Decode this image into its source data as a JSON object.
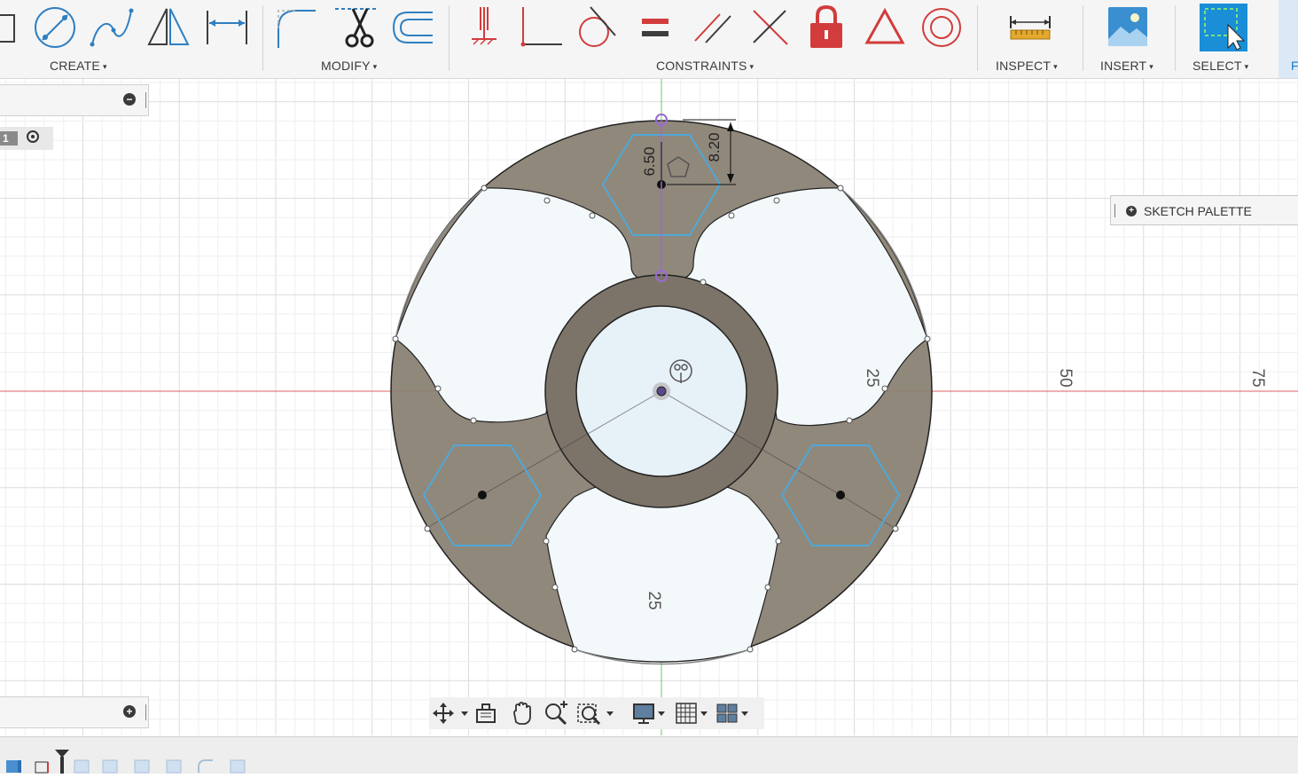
{
  "toolbar": {
    "groups": [
      {
        "label": "CREATE",
        "caret": "▾"
      },
      {
        "label": "MODIFY",
        "caret": "▾"
      },
      {
        "label": "CONSTRAINTS",
        "caret": "▾"
      },
      {
        "label": "INSPECT",
        "caret": "▾"
      },
      {
        "label": "INSERT",
        "caret": "▾"
      },
      {
        "label": "SELECT",
        "caret": "▾"
      }
    ],
    "edge_tab_label": "F",
    "create_tools": [
      "rectangle-icon",
      "circle-icon",
      "spline-icon",
      "mirror-icon",
      "dimension-icon"
    ],
    "modify_tools": [
      "fillet-icon",
      "trim-icon",
      "offset-icon"
    ],
    "constraint_tools": [
      "fix-icon",
      "coincident-icon",
      "tangent-icon",
      "equal-icon",
      "parallel-icon",
      "perpendicular-icon",
      "lock-icon",
      "triangle-icon",
      "concentric-icon"
    ],
    "inspect_tools": [
      "measure-icon"
    ],
    "insert_tools": [
      "insert-image-icon"
    ],
    "select_tools": [
      "select-icon"
    ]
  },
  "browser": {
    "row_number": "1"
  },
  "sketch_palette": {
    "label": "SKETCH PALETTE"
  },
  "canvas": {
    "dimension_a": "6.50",
    "dimension_b": "8.20",
    "axis_labels": [
      "25",
      "50",
      "75"
    ],
    "vertical_axis_label": "25"
  },
  "nav_bar": {
    "icons": [
      "orbit-icon",
      "look-at-icon",
      "pan-icon",
      "zoom-icon",
      "zoom-window-icon",
      "display-settings-icon",
      "grid-icon",
      "viewports-icon"
    ]
  },
  "colors": {
    "profile_fill": "#8a8274",
    "hexagon_stroke": "#4fa8d8",
    "x_axis": "#e06060",
    "y_axis": "#6cc46c",
    "constraint_red": "#d23c3c",
    "select_blue": "#1a8fd8"
  }
}
